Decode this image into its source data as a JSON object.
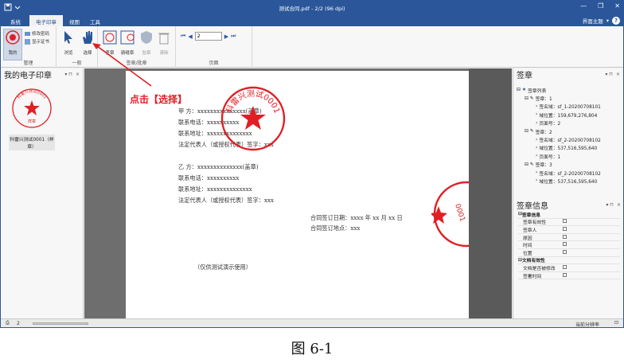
{
  "titlebar": {
    "title": "测试合同.pdf - 2/2 (96 dpi)",
    "minimize": "—",
    "restore": "❐",
    "close": "✕"
  },
  "tabs": [
    "系统",
    "电子印章",
    "视图",
    "工具"
  ],
  "theme": {
    "label": "界面主题",
    "help": "?"
  },
  "ribbon": {
    "my_btn": "我的",
    "change_pwd": "修改密码",
    "show_cert": "显示证书",
    "browse": "浏览",
    "select": "选择",
    "group_manage": "管理",
    "group_general": "一般",
    "sign": "签章",
    "cross_sign": "骑缝章",
    "verify": "验章",
    "clear": "清除",
    "group_sign": "签章/批章",
    "page_value": "2",
    "group_page": "页面"
  },
  "left_panel": {
    "title": "我的电子印章",
    "seal_label": "科雷兴测试0001（样章）",
    "seal_ring": "科雷兴测试0001",
    "seal_mark": "样章"
  },
  "document": {
    "a_party": "甲    方：xxxxxxxxxxxxxxx(盖章)",
    "a_phone": "联系电话：xxxxxxxxxx",
    "a_addr": "联系地址：xxxxxxxxxxxxxx",
    "a_rep": "法定代表人（或授权代表）签字：xxx",
    "b_party": "乙    方：xxxxxxxxxxxxxx(盖章)",
    "b_phone": "联系电话：xxxxxxxxxx",
    "b_addr": "联系地址：xxxxxxxxxxxxxx",
    "b_rep": "法定代表人（或授权代表）签字：xxx",
    "sign_date": "合同签订日期：xxxx 年 xx 月 xx 日",
    "sign_place": "合同签订地点：xxx",
    "note": "（仅供测试演示使用）",
    "stamp_ring": "科雷兴测试0001"
  },
  "signature_panel": {
    "title": "签章",
    "list_root": "签章列表",
    "items": [
      {
        "label": "签章：1",
        "name": "签名域：sf_1-20200708101",
        "area": "域位置：159,679,276,804",
        "page": "页面号：2"
      },
      {
        "label": "签章：2",
        "name": "签名域：sf_2-20200708102",
        "area": "域位置：537,516,595,640",
        "page": "页面号：1"
      },
      {
        "label": "签章：3",
        "name": "签名域：sf_2-20200708102",
        "area": "域位置：537,516,595,640"
      }
    ]
  },
  "info_panel": {
    "title": "签章信息",
    "cat1": "签章信息",
    "rows1": [
      "签章有效性",
      "签章人",
      "原因",
      "时间",
      "位置"
    ],
    "cat2": "文档有效性",
    "rows2": [
      "文档是否被修改",
      "签署时间"
    ]
  },
  "status": {
    "page": "2",
    "right": "当前分辨率"
  },
  "annotation": "点击【选择】",
  "caption": "图 6-1",
  "colors": {
    "accent": "#2b579a",
    "seal_red": "#e21e24"
  }
}
